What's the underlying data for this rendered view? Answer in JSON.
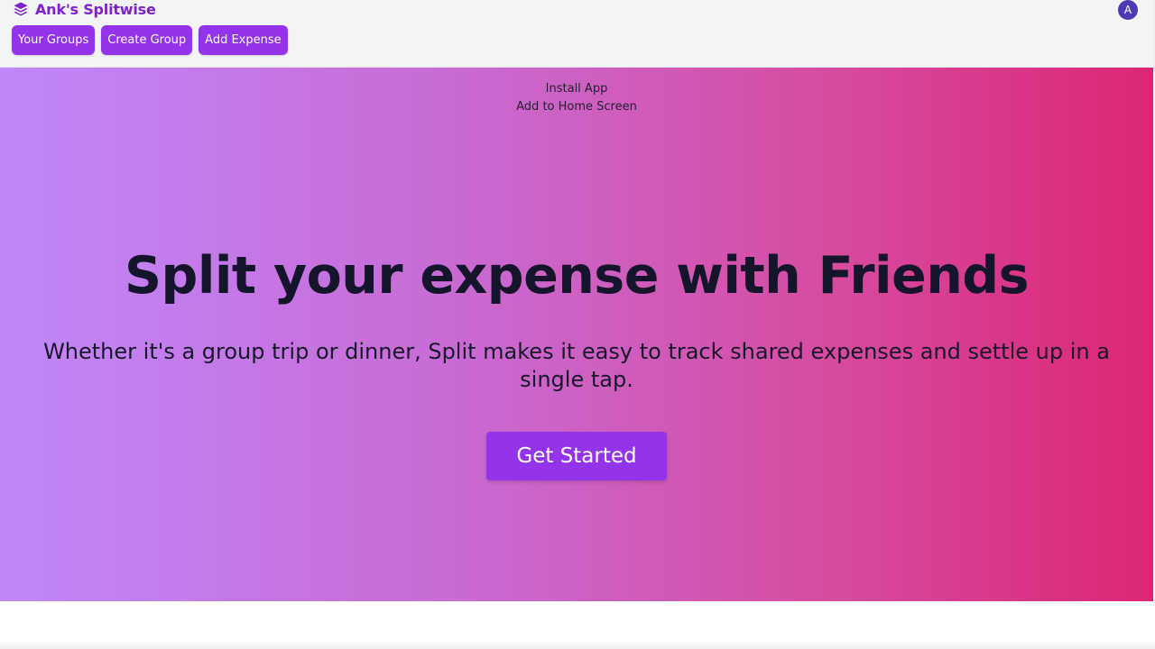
{
  "app": {
    "brand_name": "Ank's Splitwise",
    "brand_icon": "layers-icon",
    "brand_color": "#7e22ce"
  },
  "nav": {
    "items": [
      {
        "label": "Your Groups"
      },
      {
        "label": "Create Group"
      },
      {
        "label": "Add Expense"
      }
    ],
    "button_color": "#9333ea"
  },
  "user": {
    "avatar_initial": "A",
    "avatar_color": "#4c3ab5"
  },
  "install": {
    "title": "Install App",
    "subtitle": "Add to Home Screen"
  },
  "hero": {
    "headline": "Split your expense with Friends",
    "description": "Whether it's a group trip or dinner, Split makes it easy to track shared expenses and settle up in a single tap.",
    "cta_label": "Get Started",
    "gradient_start": "#c087fb",
    "gradient_end": "#dc2675"
  }
}
